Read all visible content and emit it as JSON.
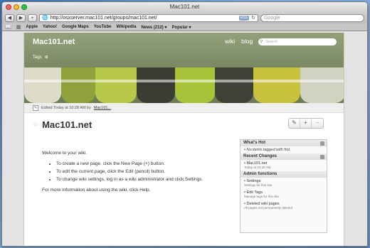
{
  "window": {
    "title": "Mac101.net"
  },
  "toolbar": {
    "back": "◀",
    "forward": "▶",
    "add": "+",
    "url": "http://osxserver.mac101.net/groups/mac101.net/",
    "rss": "RSS",
    "reload": "↻",
    "search_placeholder": "Google"
  },
  "bookmarks": {
    "items": [
      "Apple",
      "Yahoo!",
      "Google Maps",
      "YouTube",
      "Wikipedia",
      "News (212) ▾",
      "Popular ▾"
    ]
  },
  "header": {
    "site_title": "Mac101.net",
    "nav": [
      "wiki",
      "blog"
    ],
    "search_placeholder": "Search",
    "tags_label": "Tags"
  },
  "editbar": {
    "edited_text": "Edited Today at 10:28 AM by",
    "author": "Mac101..."
  },
  "page": {
    "title": "Mac101.net",
    "welcome": "Welcome to your wiki.",
    "bullets": [
      "To create a new page, click the New Page (+) button.",
      "To edit the current page, click the Edit (pencil) button.",
      "To change wiki settings, log in as a wiki administrator and click Settings."
    ],
    "help": "For more information about using the wiki, click Help."
  },
  "sidebar": {
    "whats_hot": {
      "title": "What's Hot",
      "empty": "No items tagged with hot."
    },
    "recent": {
      "title": "Recent Changes",
      "item": "Mac101.net",
      "time": "Today at 10:28 AM"
    },
    "admin": {
      "title": "Admin functions",
      "items": [
        {
          "label": "Settings",
          "sub": "Settings for this site"
        },
        {
          "label": "Edit Tags",
          "sub": "Manage tags for this site"
        },
        {
          "label": "Deleted wiki pages",
          "sub": "All pages not permanently deleted"
        }
      ]
    }
  }
}
